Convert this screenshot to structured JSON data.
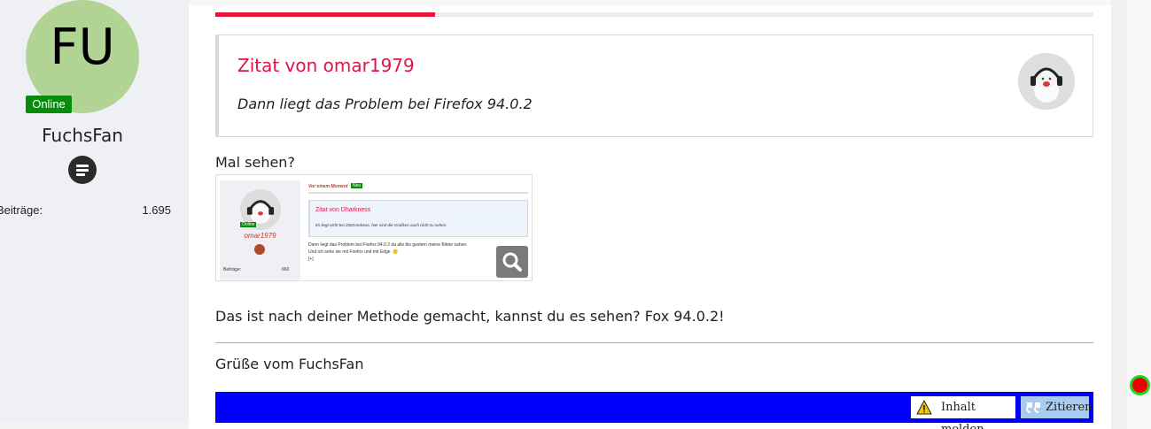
{
  "author": {
    "initials": "FU",
    "online_badge": "Online",
    "name": "FuchsFan",
    "stat_label": "Beiträge:",
    "stat_value": "1.695",
    "avatar_color": "#b1d495"
  },
  "progress": {
    "fraction": 0.25,
    "color": "#e8153b"
  },
  "quote": {
    "title": "Zitat von omar1979",
    "text": "Dann liegt das Problem bei Firefox 94.0.2"
  },
  "post": {
    "line1": "Mal sehen?",
    "line2": "Das ist nach deiner Methode gemacht, kannst du es sehen? Fox 94.0.2!",
    "signature": "Grüße vom FuchsFan"
  },
  "thumbnail": {
    "online": "Online",
    "user": "omar1979",
    "stat_label": "Beiträge:",
    "stat_value": "660",
    "time": "Vor einem Moment",
    "new_badge": "Neu",
    "quote_title": "Zitat von Dharkness",
    "quote_text": "Es liegt nicht bei 2002Andreas, hier sind die Grafiken auch nicht zu sehen.",
    "body1": "Dann liegt das Problem bei Firefox 94.0.2 da alle bis gestern meine Bilder sahen.",
    "body2": "Und ich sehe sie mit Firefox und mit Edge. 🙂",
    "body3": "[+]"
  },
  "actions": {
    "report_label": "Inhalt melden",
    "quote_label": "Zitieren",
    "bar_color": "#0000ff"
  },
  "icons": {
    "rank": "rank-icon",
    "zoom": "search-icon",
    "warning": "warning-icon",
    "quote": "quote-icon"
  }
}
